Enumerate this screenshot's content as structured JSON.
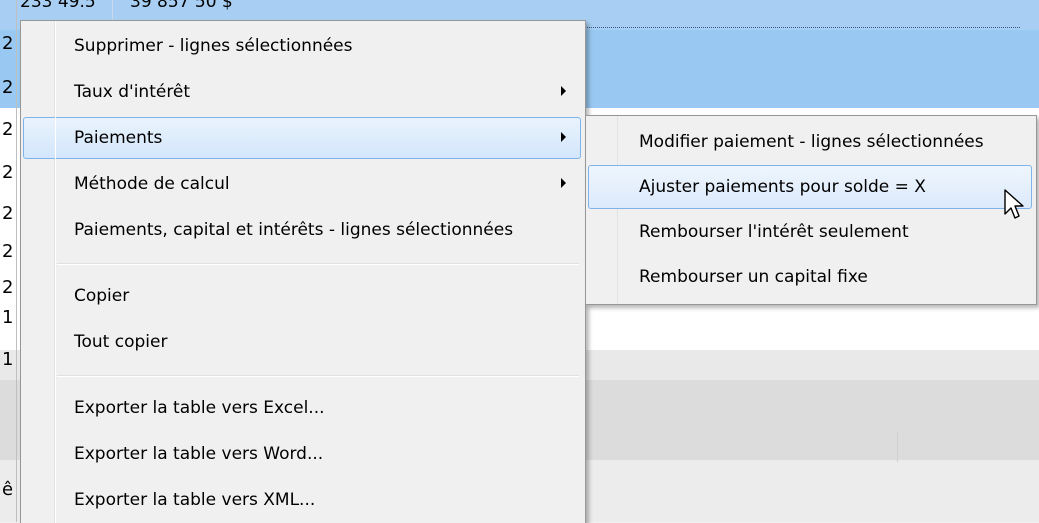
{
  "table": {
    "top_row": {
      "col1": "233 49.5",
      "col2": "39 857 50 $"
    },
    "row_fragments": [
      "2",
      "2",
      "2",
      "2",
      "2",
      "2",
      "2",
      "1",
      "1",
      "ê"
    ]
  },
  "context_menu": {
    "items": [
      {
        "label": "Supprimer - lignes sélectionnées",
        "has_submenu": false
      },
      {
        "label": "Taux d'intérêt",
        "has_submenu": true
      },
      {
        "label": "Paiements",
        "has_submenu": true,
        "highlighted": true
      },
      {
        "label": "Méthode de calcul",
        "has_submenu": true
      },
      {
        "label": "Paiements, capital et intérêts - lignes sélectionnées",
        "has_submenu": false
      },
      {
        "label": "Copier",
        "has_submenu": false
      },
      {
        "label": "Tout copier",
        "has_submenu": false
      },
      {
        "label": "Exporter la table vers Excel...",
        "has_submenu": false
      },
      {
        "label": "Exporter la table vers Word...",
        "has_submenu": false
      },
      {
        "label": "Exporter la table vers XML...",
        "has_submenu": false
      }
    ]
  },
  "submenu": {
    "parent": "Paiements",
    "items": [
      {
        "label": "Modifier paiement - lignes sélectionnées"
      },
      {
        "label": "Ajuster paiements pour solde = X",
        "highlighted": true
      },
      {
        "label": "Rembourser l'intérêt seulement"
      },
      {
        "label": "Rembourser un capital fixe"
      }
    ]
  },
  "colors": {
    "selection_band": "#99c9f3",
    "menu_background": "#f0f0f0",
    "highlight_border": "#7eb4ea"
  },
  "icons": {
    "submenu_arrow": "triangle-right-icon",
    "cursor": "mouse-pointer-icon"
  }
}
